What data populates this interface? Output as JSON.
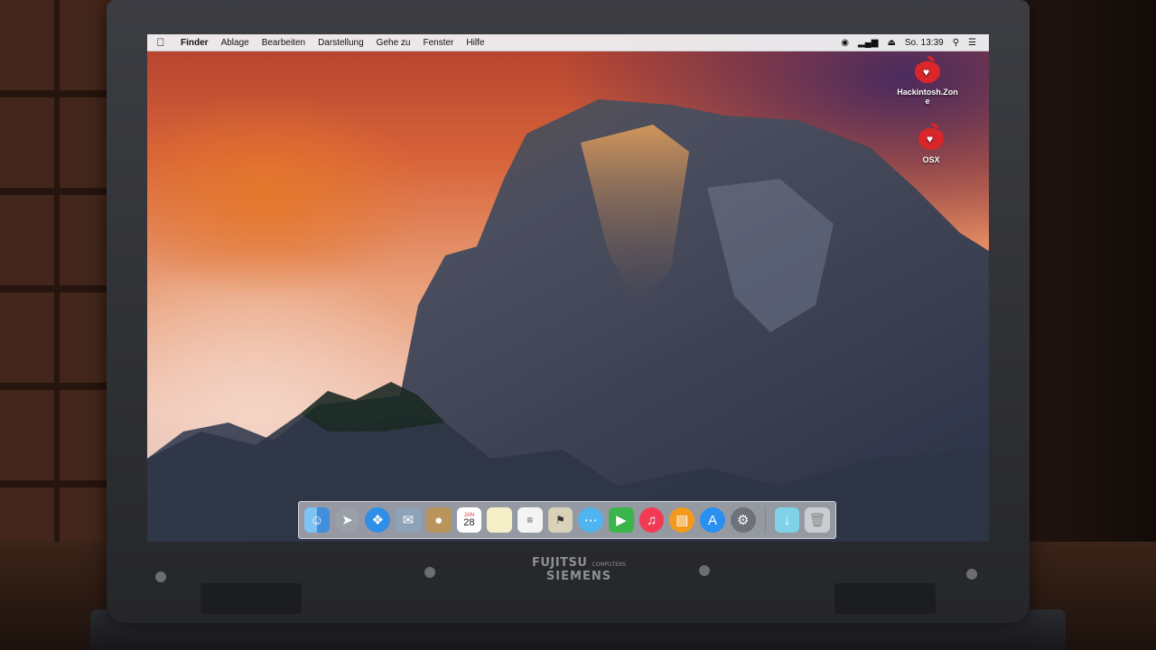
{
  "menubar": {
    "apple_icon": "apple-icon",
    "items": [
      "Finder",
      "Ablage",
      "Bearbeiten",
      "Darstellung",
      "Gehe zu",
      "Fenster",
      "Hilfe"
    ],
    "clock": "So. 13:39"
  },
  "desktop_icons": [
    {
      "label": "Hackintosh.Zon\ne",
      "icon": "hackintosh-apple-icon"
    },
    {
      "label": "OSX",
      "icon": "osx-apple-icon"
    }
  ],
  "dock": {
    "items": [
      "finder",
      "launchpad",
      "safari",
      "mail",
      "contacts",
      "calendar",
      "notes",
      "reminders",
      "maps",
      "messages",
      "facetime",
      "itunes",
      "ibooks",
      "app-store",
      "system-preferences",
      "downloads",
      "trash"
    ],
    "calendar_day": "28",
    "calendar_month": "JAN"
  },
  "laptop": {
    "brand_line1": "FUJITSU",
    "brand_line1_small": "COMPUTERS",
    "brand_line2": "SIEMENS"
  },
  "colors": {
    "menubar_bg": "#eeeef0",
    "brand_red": "#d8262a"
  }
}
